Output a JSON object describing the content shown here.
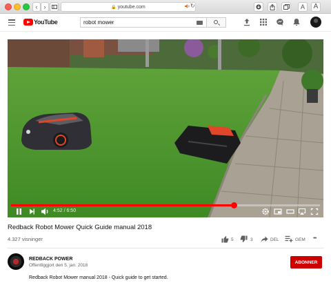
{
  "browser": {
    "url": "youtube.com"
  },
  "youtube": {
    "logo_text": "YouTube",
    "search_value": "robot mower"
  },
  "player": {
    "current_time": "4:52",
    "duration": "6:50",
    "progress": 0.72,
    "time_display": "4:52 / 6:50"
  },
  "video": {
    "title": "Redback Robot Mower Quick Guide manual 2018",
    "views": "4.327 visninger",
    "likes": "5",
    "dislikes": "3",
    "share_label": "DEL",
    "save_label": "GEM",
    "more_label": "•••"
  },
  "channel": {
    "name": "REDBACK POWER",
    "published": "Offentliggjort den 5. jan. 2018",
    "subscribe_label": "ABONNER",
    "description": "Redback Robot Mower manual 2018 - Quick guide to get started."
  },
  "colors": {
    "brand_red": "#ff0000",
    "subscribe_red": "#cc0000",
    "progress_red": "#ff0000"
  }
}
